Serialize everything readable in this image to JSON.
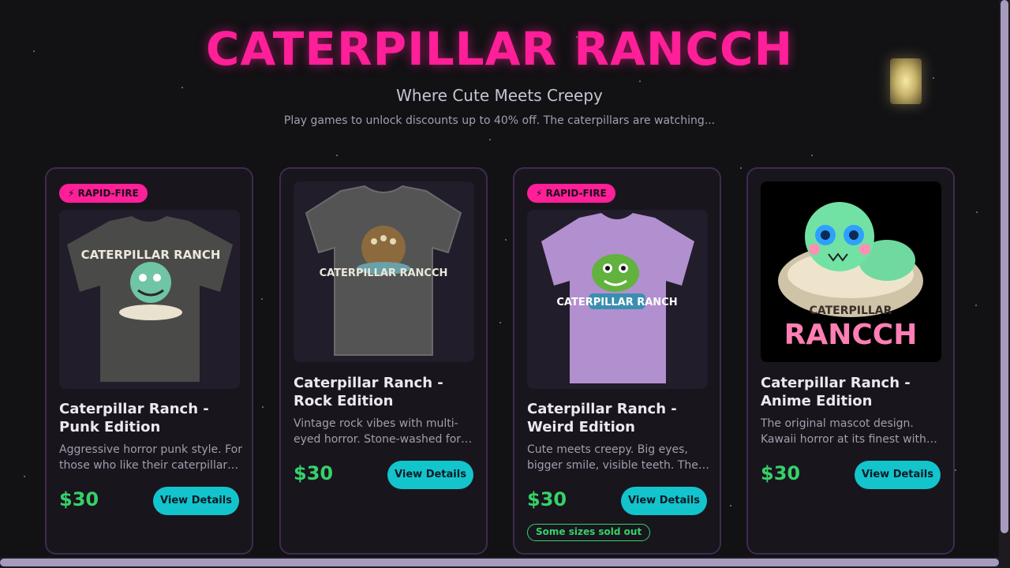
{
  "header": {
    "title": "CATERPILLAR RANCCH",
    "subtitle": "Where Cute Meets Creepy",
    "tagline": "Play games to unlock discounts up to 40% off. The caterpillars are watching..."
  },
  "colors": {
    "accent": "#ff1f98",
    "price": "#36d16a",
    "button": "#13c4cd",
    "background": "#121114"
  },
  "products": [
    {
      "badge": "⚡ RAPID-FIRE",
      "title": "Caterpillar Ranch - Punk Edition",
      "description": "Aggressive horror punk style. For those who like their caterpillars with attitude.",
      "price": "$30",
      "button": "View Details",
      "image_text": "CATERPILLAR RANCH",
      "shirt_color": "#4a4a49"
    },
    {
      "title": "Caterpillar Ranch - Rock Edition",
      "description": "Vintage rock vibes with multi-eyed horror. Stone-washed for that worn-in look.",
      "price": "$30",
      "button": "View Details",
      "image_text": "CATERPILLAR RANCCH",
      "shirt_color": "#545454"
    },
    {
      "badge": "⚡ RAPID-FIRE",
      "title": "Caterpillar Ranch - Weird Edition",
      "description": "Cute meets creepy. Big eyes, bigger smile, visible teeth. The weirdest one yet.",
      "price": "$30",
      "button": "View Details",
      "status": "Some sizes sold out",
      "image_text": "CATERPILLAR RANCH",
      "shirt_color": "#b28fce"
    },
    {
      "title": "Caterpillar Ranch - Anime Edition",
      "description": "The original mascot design. Kawaii horror at its finest with dripping slime.",
      "price": "$30",
      "button": "View Details",
      "image_text_top": "CATERPILLAR",
      "image_text_bottom": "RANCCH"
    }
  ]
}
